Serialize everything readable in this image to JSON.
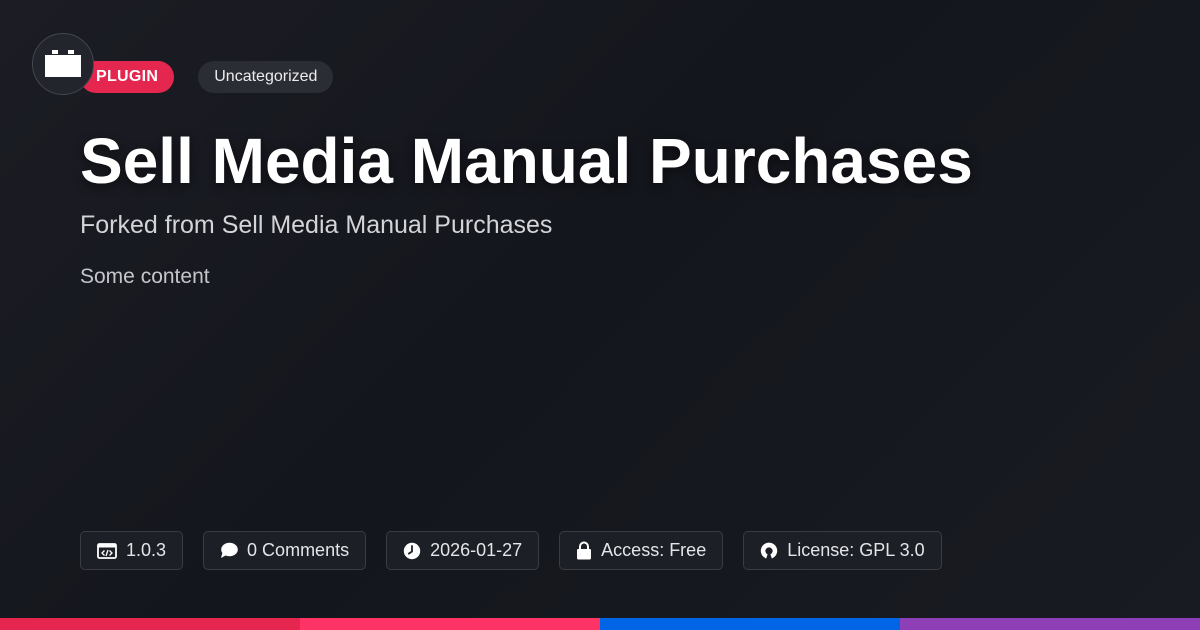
{
  "tags": {
    "type_label": "PLUGIN",
    "category_label": "Uncategorized"
  },
  "header": {
    "title": "Sell Media Manual Purchases",
    "subtitle": "Forked from Sell Media Manual Purchases",
    "content": "Some content"
  },
  "meta": {
    "version": "1.0.3",
    "comments": "0 Comments",
    "date": "2026-01-27",
    "access": "Access: Free",
    "license": "License: GPL 3.0"
  },
  "icons": {
    "logo": "plugin-block-icon",
    "version": "code-window-icon",
    "comments": "speech-bubble-icon",
    "date": "clock-icon",
    "access": "lock-icon",
    "license": "open-source-icon"
  },
  "colors": {
    "accent": "#e5264f",
    "bar": [
      "#e5264f",
      "#ff3366",
      "#0066e6",
      "#8f3fb5"
    ]
  }
}
